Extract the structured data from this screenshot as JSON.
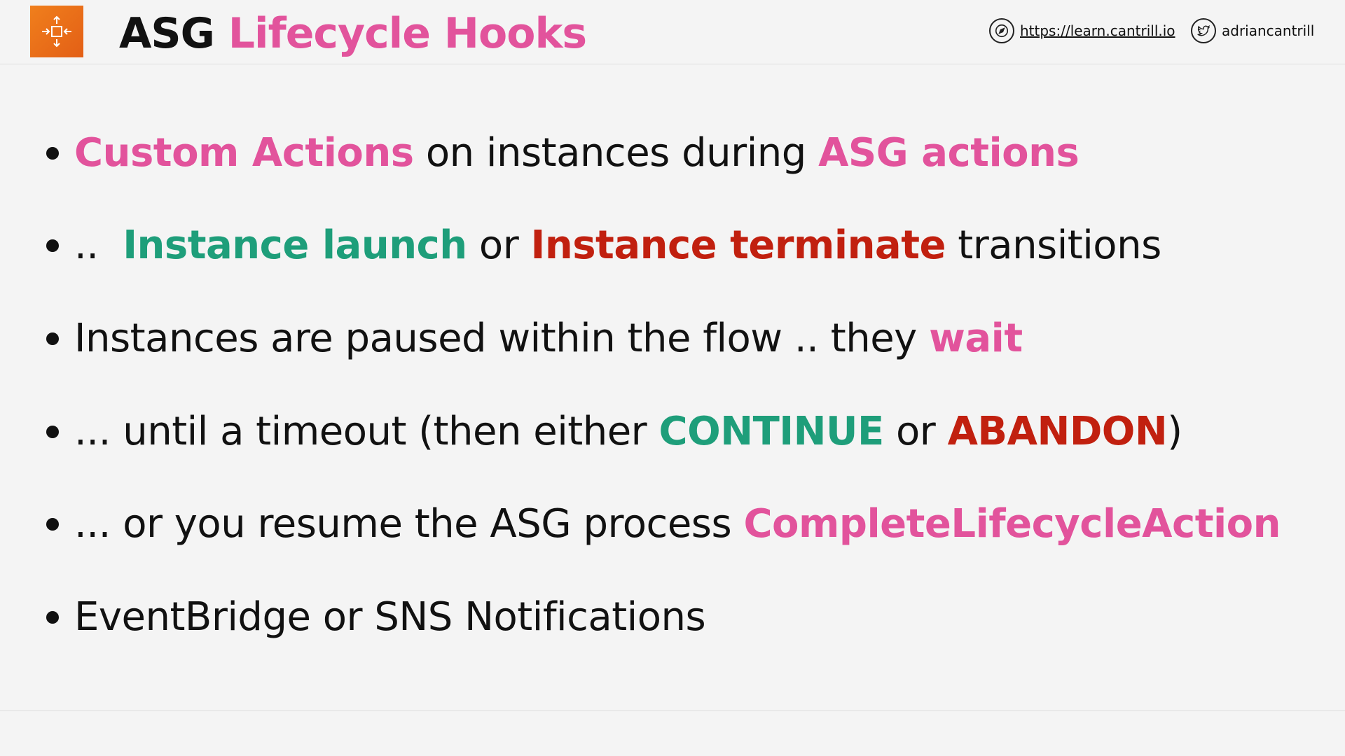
{
  "header": {
    "title_part1": "ASG",
    "title_part2": "Lifecycle Hooks",
    "logo_icon": "auto-scaling-icon",
    "link_text": "https://learn.cantrill.io",
    "link_icon": "compass-icon",
    "handle_text": "adriancantrill",
    "handle_icon": "twitter-icon"
  },
  "colors": {
    "accent_pink": "#e2539c",
    "accent_green": "#1e9e7a",
    "accent_red": "#c1200f",
    "logo_orange": "#e8701a"
  },
  "bullets": [
    {
      "segments": [
        {
          "text": "Custom Actions",
          "style": "pink"
        },
        {
          "text": " on instances during ",
          "style": "plain"
        },
        {
          "text": "ASG actions",
          "style": "pink"
        }
      ]
    },
    {
      "segments": [
        {
          "text": "..  ",
          "style": "plain"
        },
        {
          "text": "Instance launch",
          "style": "green"
        },
        {
          "text": " or ",
          "style": "plain"
        },
        {
          "text": "Instance terminate",
          "style": "red"
        },
        {
          "text": " transitions",
          "style": "plain"
        }
      ]
    },
    {
      "segments": [
        {
          "text": "Instances are paused within the flow .. they ",
          "style": "plain"
        },
        {
          "text": "wait",
          "style": "pink"
        }
      ]
    },
    {
      "segments": [
        {
          "text": "... until a timeout (then either ",
          "style": "plain"
        },
        {
          "text": "CONTINUE",
          "style": "green"
        },
        {
          "text": " or ",
          "style": "plain"
        },
        {
          "text": "ABANDON",
          "style": "red"
        },
        {
          "text": ")",
          "style": "plain"
        }
      ]
    },
    {
      "segments": [
        {
          "text": "... or you resume the ASG process ",
          "style": "plain"
        },
        {
          "text": "CompleteLifecycleAction",
          "style": "pink"
        }
      ]
    },
    {
      "segments": [
        {
          "text": "EventBridge or SNS Notifications",
          "style": "plain"
        }
      ]
    }
  ]
}
